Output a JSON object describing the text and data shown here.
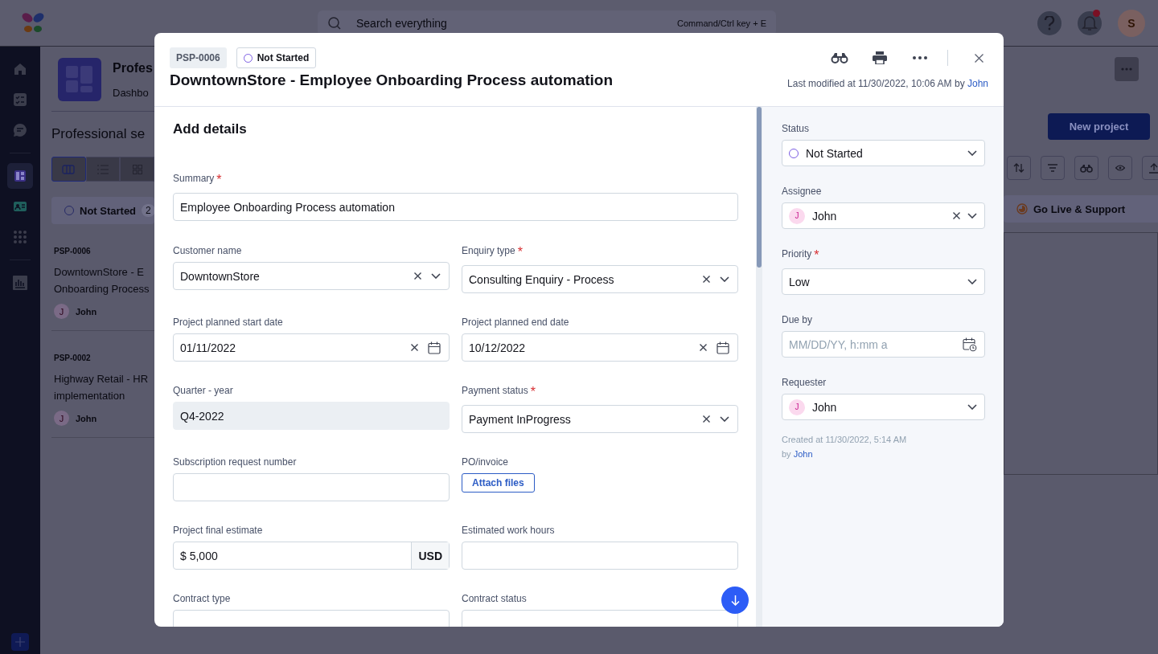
{
  "topbar": {
    "search_placeholder": "Search everything",
    "shortcut": "Command/Ctrl key + E",
    "has_notification": true,
    "user_initial": "S"
  },
  "nav": [
    {
      "kind": "home",
      "selected": false
    },
    {
      "kind": "tasks",
      "selected": false
    },
    {
      "kind": "chat",
      "selected": false
    },
    {
      "kind": "board",
      "selected": true
    },
    {
      "kind": "contact",
      "selected": false
    },
    {
      "kind": "apps",
      "selected": false
    },
    {
      "kind": "reports",
      "selected": false
    }
  ],
  "background": {
    "header_title": "Profes",
    "header_subtitle": "Dashbo",
    "page_title": "Professional se",
    "new_project": "New project",
    "views": [
      {
        "kind": "columns",
        "selected": true
      },
      {
        "kind": "list",
        "selected": false
      },
      {
        "kind": "grid",
        "selected": false
      }
    ],
    "left_column": {
      "title": "Not Started",
      "count": "2"
    },
    "right_column": {
      "title": "Go Live & Support"
    },
    "cards": [
      {
        "id": "PSP-0006",
        "title_lines": [
          "DowntownStore - E",
          "Onboarding Process"
        ],
        "assignee": "John",
        "initial": "J"
      },
      {
        "id": "PSP-0002",
        "title_lines": [
          "Highway Retail - HR",
          "implementation"
        ],
        "assignee": "John",
        "initial": "J"
      }
    ]
  },
  "modal": {
    "id": "PSP-0006",
    "status": "Not Started",
    "title": "DowntownStore - Employee Onboarding Process automation",
    "last_modified": "Last modified at 11/30/2022, 10:06 AM by",
    "last_modified_by": "John",
    "section": "Add details",
    "summary": {
      "label": "Summary",
      "required_mark": "*",
      "value": "Employee Onboarding Process automation"
    },
    "fields": [
      {
        "kind": "select",
        "label": "Customer name",
        "value": "DowntownStore",
        "clearable": true
      },
      {
        "kind": "select",
        "label": "Enquiry type",
        "required_mark": "*",
        "value": "Consulting Enquiry - Process",
        "clearable": true
      },
      {
        "kind": "date",
        "label": "Project planned start date",
        "value": "01/11/2022",
        "clearable": true
      },
      {
        "kind": "date",
        "label": "Project planned end date",
        "value": "10/12/2022",
        "clearable": true
      },
      {
        "kind": "readonly",
        "label": "Quarter - year",
        "value": "Q4-2022"
      },
      {
        "kind": "select",
        "label": "Payment status",
        "required_mark": "*",
        "value": "Payment InProgress",
        "clearable": true
      },
      {
        "kind": "text",
        "label": "Subscription request number"
      },
      {
        "kind": "attach",
        "label": "PO/invoice",
        "button": "Attach files"
      },
      {
        "kind": "currency",
        "label": "Project final estimate",
        "value": "$ 5,000",
        "unit": "USD"
      },
      {
        "kind": "text",
        "label": "Estimated work hours"
      },
      {
        "kind": "text",
        "label": "Contract type"
      },
      {
        "kind": "text",
        "label": "Contract status"
      }
    ],
    "side": [
      {
        "kind": "status",
        "label": "Status",
        "value": "Not Started",
        "clearable": false
      },
      {
        "kind": "person",
        "label": "Assignee",
        "value": "John",
        "initial": "J",
        "clearable": true
      },
      {
        "kind": "select",
        "label": "Priority",
        "required_mark": "*",
        "value": "Low",
        "clearable": false
      },
      {
        "kind": "datetime",
        "label": "Due by",
        "placeholder": "MM/DD/YY, h:mm a"
      },
      {
        "kind": "person",
        "label": "Requester",
        "value": "John",
        "initial": "J",
        "clearable": false
      }
    ],
    "created": "Created at 11/30/2022, 5:14 AM",
    "created_by_prefix": "by",
    "created_by": "John"
  }
}
